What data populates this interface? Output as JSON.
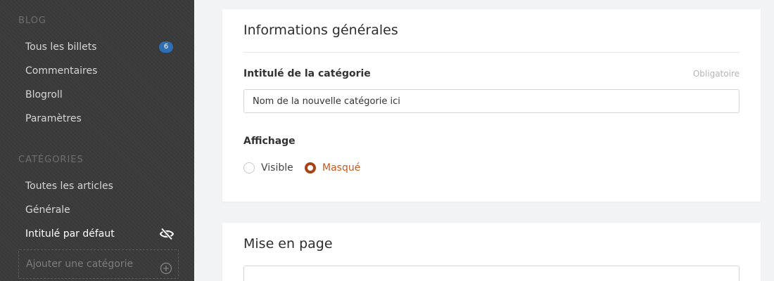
{
  "sidebar": {
    "blog_title": "BLOG",
    "blog_items": [
      {
        "label": "Tous les billets",
        "badge": "6"
      },
      {
        "label": "Commentaires"
      },
      {
        "label": "Blogroll"
      },
      {
        "label": "Paramètres"
      }
    ],
    "categories_title": "CATÉGORIES",
    "category_items": [
      {
        "label": "Toutes les articles"
      },
      {
        "label": "Générale"
      },
      {
        "label": "Intitulé par défaut",
        "hidden_icon": "eye-off-icon"
      }
    ],
    "add_category_label": "Ajouter une catégorie"
  },
  "general_card": {
    "title": "Informations générales",
    "name_field": {
      "label": "Intitulé de la catégorie",
      "required_text": "Obligatoire",
      "value": "Nom de la nouvelle catégorie ici"
    },
    "display": {
      "label": "Affichage",
      "options": [
        "Visible",
        "Masqué"
      ],
      "selected": "Masqué"
    }
  },
  "layout_card": {
    "title": "Mise en page"
  },
  "colors": {
    "accent": "#a84216",
    "badge": "#2f6fb5"
  }
}
